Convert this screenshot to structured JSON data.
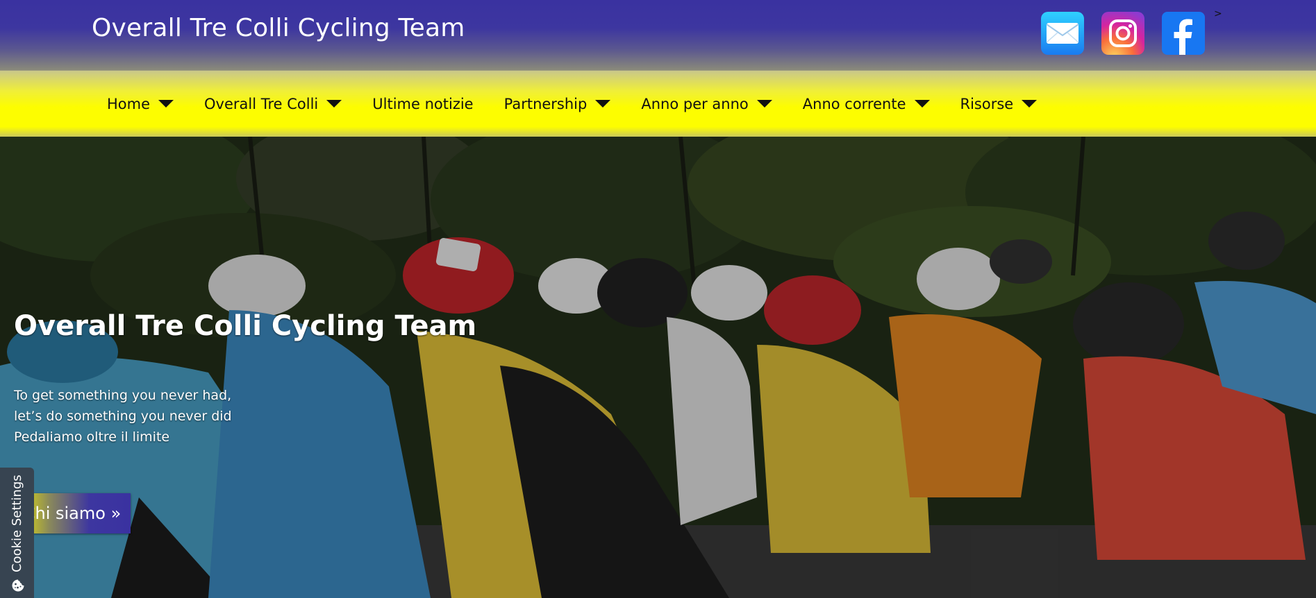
{
  "header": {
    "site_title": "Overall Tre Colli Cycling Team",
    "social": [
      {
        "name": "mail-icon",
        "label": "Email"
      },
      {
        "name": "instagram-icon",
        "label": "Instagram"
      },
      {
        "name": "facebook-icon",
        "label": "Facebook"
      }
    ],
    "stray_text": ">"
  },
  "nav": {
    "items": [
      {
        "label": "Home",
        "has_dropdown": true
      },
      {
        "label": "Overall Tre Colli",
        "has_dropdown": true
      },
      {
        "label": "Ultime notizie",
        "has_dropdown": false
      },
      {
        "label": "Partnership",
        "has_dropdown": true
      },
      {
        "label": "Anno per anno",
        "has_dropdown": true
      },
      {
        "label": "Anno corrente",
        "has_dropdown": true
      },
      {
        "label": "Risorse",
        "has_dropdown": true
      }
    ]
  },
  "hero": {
    "title": "Overall Tre Colli Cycling Team",
    "lines": [
      "To get something you never had,",
      "let’s do something you never did",
      "Pedaliamo oltre il limite"
    ],
    "cta_label": "Chi siamo »"
  },
  "cookie": {
    "label": "Cookie Settings",
    "icon": "cookie-icon"
  },
  "colors": {
    "header_blue": "#3a32a0",
    "nav_yellow": "#fdfd00",
    "cookie_tab": "#374451"
  }
}
